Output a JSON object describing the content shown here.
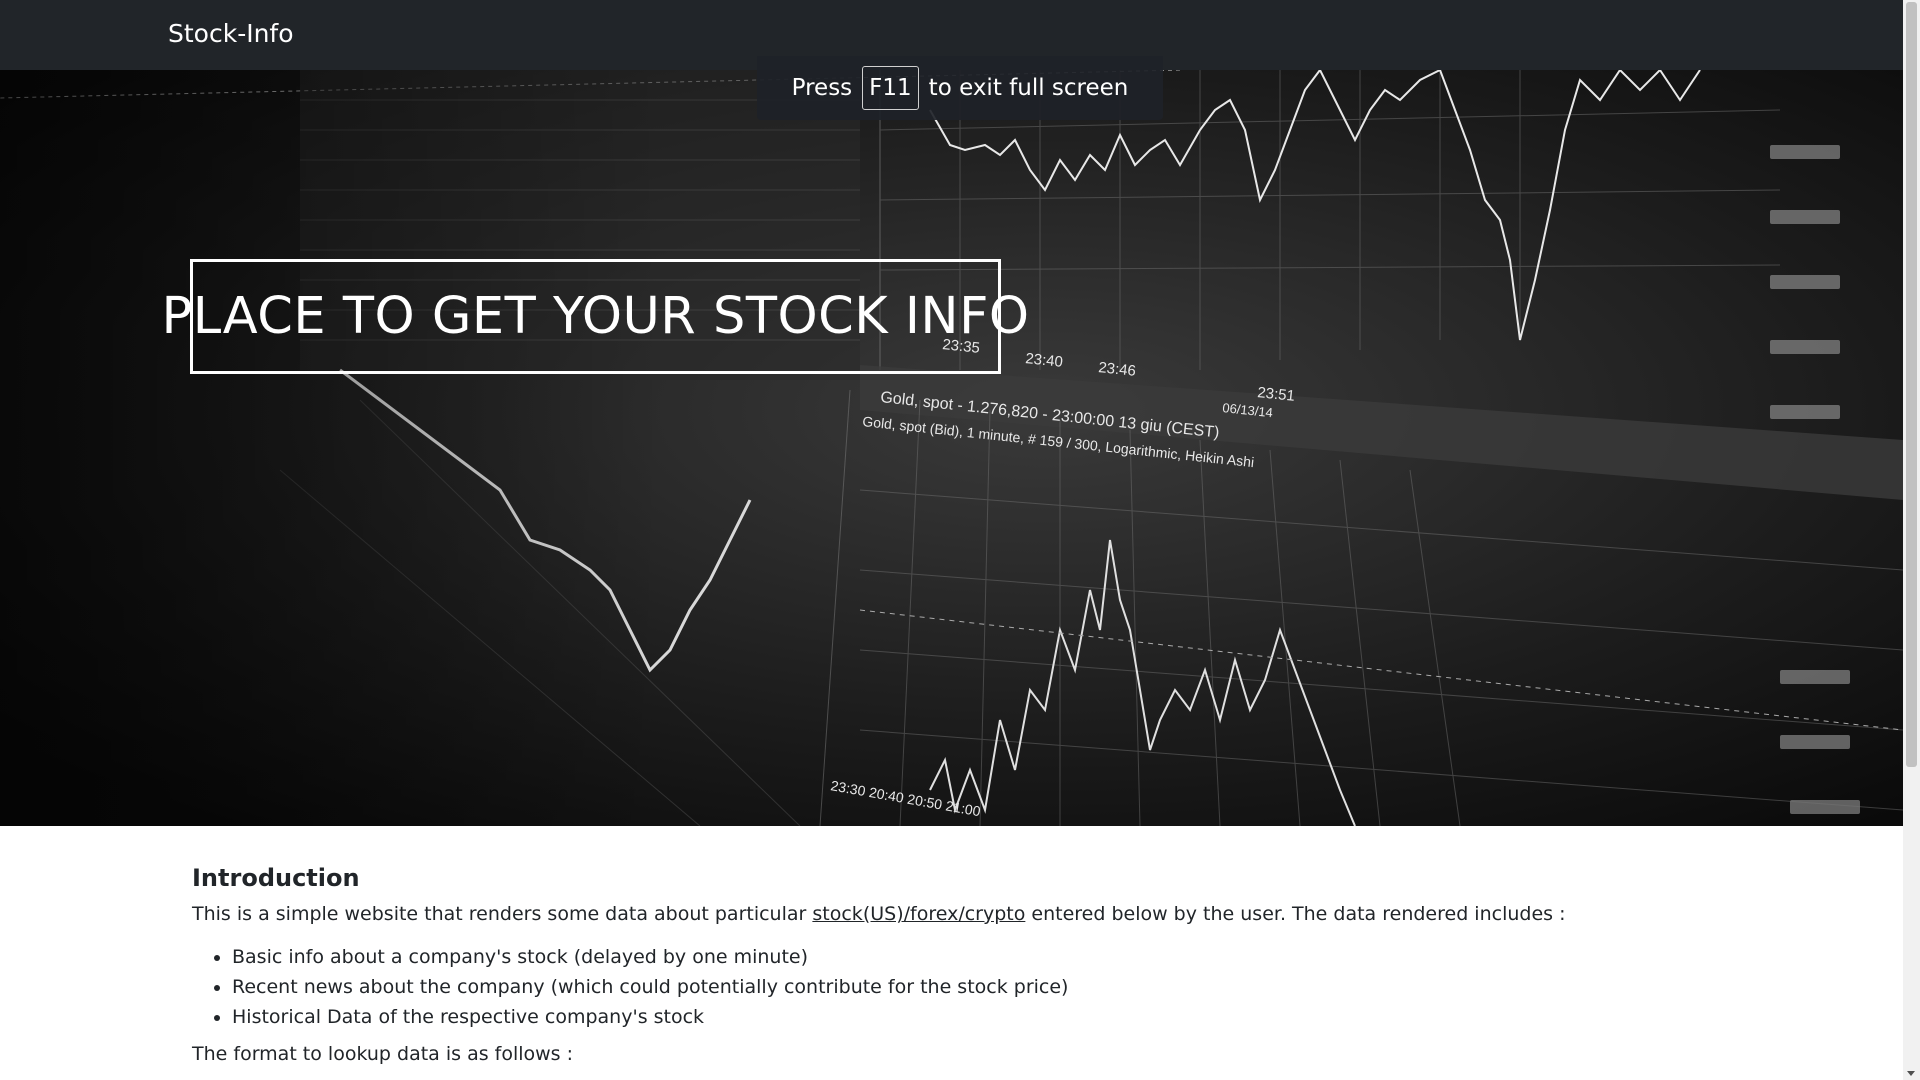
{
  "nav": {
    "brand": "Stock-Info"
  },
  "fullscreen_hint": {
    "prefix": "Press",
    "key": "F11",
    "suffix": "to exit full screen"
  },
  "hero": {
    "title": "PLACE TO GET YOUR STOCK INFO",
    "chart_labels": {
      "time_1": "23:35",
      "time_2": "23:40",
      "time_3": "23:46",
      "time_4": "23:51",
      "date_1": "06/13/14",
      "series_title": "Gold, spot - 1.276,820 - 23:00:00 13 giu (CEST)",
      "series_subtitle": "Gold, spot (Bid), 1 minute, # 159 / 300, Logarithmic, Heikin Ashi",
      "bottom_times": "23:30 20:40 20:50 21:00"
    }
  },
  "intro": {
    "heading": "Introduction",
    "text_before": "This is a simple website that renders some data about particular ",
    "link_text": "stock(US)/forex/crypto",
    "text_after": " entered below by the user. The data rendered includes :",
    "items": [
      "Basic info about a company's stock (delayed by one minute)",
      "Recent news about the company (which could potentially contribute for the stock price)",
      "Historical Data of the respective company's stock"
    ],
    "format_text": "The format to lookup data is as follows :"
  }
}
